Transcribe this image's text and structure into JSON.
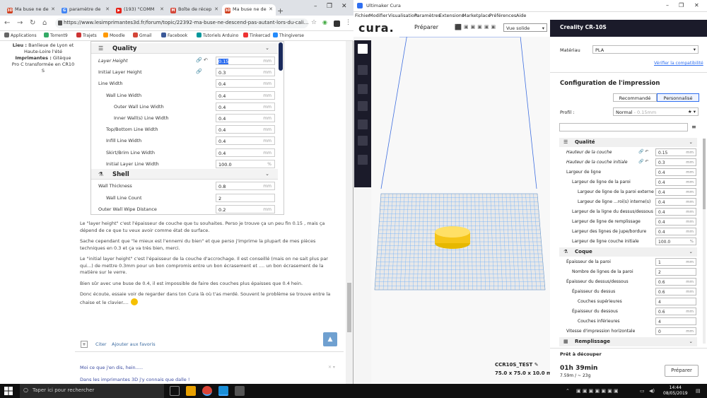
{
  "chrome": {
    "tabs": [
      {
        "label": "Ma buse ne de",
        "fav": "3D",
        "color": "#d04020"
      },
      {
        "label": "paramètre de",
        "fav": "G",
        "color": "#4285f4"
      },
      {
        "label": "(193) \"COMM",
        "fav": "▶",
        "color": "#e62117"
      },
      {
        "label": "Boîte de récep",
        "fav": "M",
        "color": "#d44638"
      },
      {
        "label": "Ma buse ne de",
        "fav": "3D",
        "color": "#d04020"
      }
    ],
    "new_tab": "+",
    "url": "https://www.lesimprimantes3d.fr/forum/topic/22392-ma-buse-ne-descend-pas-autant-lors-du-cali...",
    "bookmarks": [
      {
        "label": "Applications",
        "color": "#666"
      },
      {
        "label": "Torrent9",
        "color": "#3a6"
      },
      {
        "label": "Trajets",
        "color": "#c33"
      },
      {
        "label": "Moodle",
        "color": "#f90"
      },
      {
        "label": "Gmail",
        "color": "#d44638"
      },
      {
        "label": "Facebook",
        "color": "#3b5998"
      },
      {
        "label": "Tutoriels Arduino",
        "color": "#00979c"
      },
      {
        "label": "Tinkercad",
        "color": "#e33"
      },
      {
        "label": "Thingiverse",
        "color": "#248bfb"
      }
    ],
    "profile": {
      "lieu_label": "Lieu :",
      "lieu_value": "Banlieue de Lyon et Haute-Loire l'été",
      "imprimantes_label": "Imprimantes :",
      "imprimantes_value": "Gitèque Pro C transformée en CR10 S"
    },
    "settings_image": {
      "categories": [
        {
          "label": "Quality",
          "icon": "quality-icon",
          "glyph": "☰"
        },
        {
          "label": "Shell",
          "icon": "shell-icon",
          "glyph": "⚗"
        }
      ],
      "quality_rows": [
        {
          "label": "Layer Height",
          "value": "0.15",
          "unit": "mm",
          "indent": 0,
          "italic": true,
          "tools": "🔗 ↶",
          "highlight": true
        },
        {
          "label": "Initial Layer Height",
          "value": "0.3",
          "unit": "mm",
          "indent": 0,
          "italic": false,
          "tools": "🔗"
        },
        {
          "label": "Line Width",
          "value": "0.4",
          "unit": "mm",
          "indent": 0
        },
        {
          "label": "Wall Line Width",
          "value": "0.4",
          "unit": "mm",
          "indent": 1
        },
        {
          "label": "Outer Wall Line Width",
          "value": "0.4",
          "unit": "mm",
          "indent": 2
        },
        {
          "label": "Inner Wall(s) Line Width",
          "value": "0.4",
          "unit": "mm",
          "indent": 2
        },
        {
          "label": "Top/Bottom Line Width",
          "value": "0.4",
          "unit": "mm",
          "indent": 1
        },
        {
          "label": "Infill Line Width",
          "value": "0.4",
          "unit": "mm",
          "indent": 1
        },
        {
          "label": "Skirt/Brim Line Width",
          "value": "0.4",
          "unit": "mm",
          "indent": 1
        },
        {
          "label": "Initial Layer Line Width",
          "value": "100.0",
          "unit": "%",
          "indent": 1
        }
      ],
      "shell_rows": [
        {
          "label": "Wall Thickness",
          "value": "0.8",
          "unit": "mm",
          "indent": 0
        },
        {
          "label": "Wall Line Count",
          "value": "2",
          "unit": "",
          "indent": 1
        },
        {
          "label": "Outer Wall Wipe Distance",
          "value": "0.2",
          "unit": "mm",
          "indent": 0
        }
      ]
    },
    "post": {
      "p1": "Le \"layer height\" c'est l'épaisseur de couche que tu souhaites. Perso je trouve ça un peu fin 0.15 , mais ça dépend de ce que tu veux avoir comme état de surface.",
      "p2": "Sache cependant que \"le mieux est l'ennemi du bien\" et que perso j'imprime la plupart de mes pièces techniques en 0.3 et ça va très bien, merci.",
      "p3": "Le \"initial layer height\" c'est l'épaisseur de la couche d'accrochage. Il est conseillé (mais on ne sait plus par qui...) de mettre 0.3mm pour un bon compromis entre  un bon écrasement et .... un bon écrasement de la matière sur le verre.",
      "p4": "Bien sûr avec une buse de 0.4, il est impossible de faire des couches plus épaisses que 0.4 hein.",
      "p5": "Donc écoute, essaie voir de regarder dans ton Cura là où t'as merdé. Souvent le problème se trouve entre la chaise et le clavier...."
    },
    "actions": {
      "plus": "+",
      "quote": "Citer",
      "fav": "Ajouter aux favoris"
    },
    "links": {
      "l1": "Moi ce que j'en dis, hein.....",
      "l2": "Dans les imprimantes 3D j'y connais que dalle !"
    }
  },
  "cura": {
    "title": "Ultimaker Cura",
    "menu": [
      "Fichier",
      "Modifier",
      "Visualisation",
      "Paramètres",
      "Extensions",
      "Marketplace",
      "Préférences",
      "Aide"
    ],
    "logo": "cura.",
    "tab_prepare": "Préparer",
    "view_select": "Vue solide",
    "printer": "Creality CR-10S",
    "material_label": "Matériau",
    "material_value": "PLA",
    "compat_link": "Vérifier la compatibilité",
    "config_title": "Configuration de l'impression",
    "btn_recommended": "Recommandé",
    "btn_custom": "Personnalisé",
    "profile_label": "Profil :",
    "profile_value": "Normal",
    "profile_sub": "- 0.15mm",
    "categories": {
      "quality": "Qualité",
      "shell": "Coque",
      "infill": "Remplissage"
    },
    "quality_rows": [
      {
        "label": "Hauteur de la couche",
        "value": "0.15",
        "unit": "mm",
        "indent": 0,
        "italic": true,
        "tools": "🔗 ↶"
      },
      {
        "label": "Hauteur de la couche initiale",
        "value": "0.3",
        "unit": "mm",
        "indent": 0,
        "italic": true,
        "tools": "🔗 ↶"
      },
      {
        "label": "Largeur de ligne",
        "value": "0.4",
        "unit": "mm",
        "indent": 0
      },
      {
        "label": "Largeur de ligne de la paroi",
        "value": "0.4",
        "unit": "mm",
        "indent": 1
      },
      {
        "label": "Largeur de ligne de la paroi externe",
        "value": "0.4",
        "unit": "mm",
        "indent": 2
      },
      {
        "label": "Largeur de ligne ...roi(s) interne(s)",
        "value": "0.4",
        "unit": "mm",
        "indent": 2
      },
      {
        "label": "Largeur de la ligne du dessus/dessous",
        "value": "0.4",
        "unit": "mm",
        "indent": 1
      },
      {
        "label": "Largeur de ligne de remplissage",
        "value": "0.4",
        "unit": "mm",
        "indent": 1
      },
      {
        "label": "Largeur des lignes de jupe/bordure",
        "value": "0.4",
        "unit": "mm",
        "indent": 1
      },
      {
        "label": "Largeur de ligne couche initiale",
        "value": "100.0",
        "unit": "%",
        "indent": 1
      }
    ],
    "shell_rows": [
      {
        "label": "Épaisseur de la paroi",
        "value": "1",
        "unit": "mm",
        "indent": 0
      },
      {
        "label": "Nombre de lignes de la paroi",
        "value": "2",
        "unit": "",
        "indent": 1
      },
      {
        "label": "Épaisseur du dessus/dessous",
        "value": "0.6",
        "unit": "mm",
        "indent": 0
      },
      {
        "label": "Épaisseur du dessus",
        "value": "0.6",
        "unit": "mm",
        "indent": 1
      },
      {
        "label": "Couches supérieures",
        "value": "4",
        "unit": "",
        "indent": 2
      },
      {
        "label": "Épaisseur du dessous",
        "value": "0.6",
        "unit": "mm",
        "indent": 1
      },
      {
        "label": "Couches inférieures",
        "value": "4",
        "unit": "",
        "indent": 2
      },
      {
        "label": "Vitesse d'impression horizontale",
        "value": "0",
        "unit": "mm",
        "indent": 0
      }
    ],
    "ready_label": "Prêt à découper",
    "time": "01h 39min",
    "material_usage": "7.59m / ~ 23g",
    "prepare_button": "Préparer",
    "job_name": "CCR10S_TEST",
    "job_dims": "75.0 x 75.0 x 10.0 mm"
  },
  "taskbar": {
    "search_placeholder": "Taper ici pour rechercher",
    "time": "14:44",
    "date": "08/05/2019"
  }
}
